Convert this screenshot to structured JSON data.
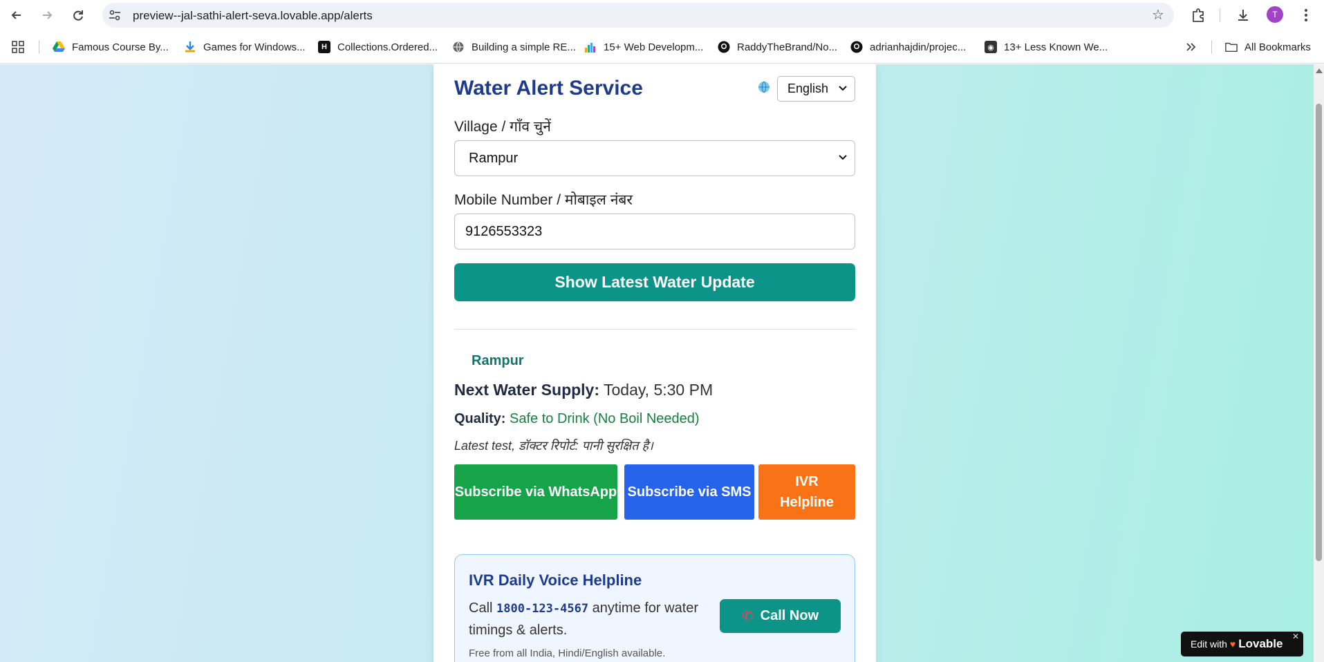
{
  "browser": {
    "url": "preview--jal-sathi-alert-seva.lovable.app/alerts",
    "avatar_initial": "T",
    "bookmarks": [
      {
        "label": "Famous Course By...",
        "icon": "google-drive-icon"
      },
      {
        "label": "Games for Windows...",
        "icon": "download-icon"
      },
      {
        "label": "Collections.Ordered...",
        "icon": "hackernoon-icon"
      },
      {
        "label": "Building a simple RE...",
        "icon": "globe-icon"
      },
      {
        "label": "15+ Web Developm...",
        "icon": "bars-icon"
      },
      {
        "label": "RaddyTheBrand/No...",
        "icon": "github-icon"
      },
      {
        "label": "adrianhajdin/projec...",
        "icon": "github-icon"
      },
      {
        "label": "13+ Less Known We...",
        "icon": "dev-icon"
      }
    ],
    "all_bookmarks_label": "All Bookmarks"
  },
  "app": {
    "title": "Water Alert Service",
    "language_selected": "English",
    "village_label": "Village / गाँव चुनें",
    "village_selected": "Rampur",
    "mobile_label": "Mobile Number / मोबाइल नंबर",
    "mobile_value": "9126553323",
    "show_button": "Show Latest Water Update"
  },
  "result": {
    "village": "Rampur",
    "next_supply_label": "Next Water Supply:",
    "next_supply_value": "Today, 5:30 PM",
    "quality_label": "Quality:",
    "quality_value": "Safe to Drink (No Boil Needed)",
    "note": "Latest test, डॉक्टर रिपोर्ट: पानी सुरक्षित है।"
  },
  "subscribe": {
    "whatsapp": "Subscribe via WhatsApp",
    "sms": "Subscribe via SMS",
    "ivr": "IVR Helpline"
  },
  "ivr_card": {
    "heading": "IVR Daily Voice Helpline",
    "call_prefix": "Call",
    "phone": "1800-123-4567",
    "call_suffix": "anytime for water timings & alerts.",
    "free_note": "Free from all India, Hindi/English available.",
    "call_button": "Call Now"
  },
  "badge": {
    "prefix": "Edit with",
    "brand": "Lovable"
  },
  "colors": {
    "primary_teal": "#0d9488",
    "whatsapp_green": "#16a34a",
    "sms_blue": "#2563eb",
    "ivr_orange": "#f97316",
    "title_navy": "#1e3a8a"
  }
}
